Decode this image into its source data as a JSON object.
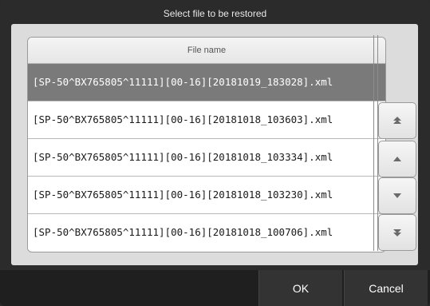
{
  "dialog": {
    "title": "Select file to be restored",
    "column_header": "File name",
    "selected_index": 0,
    "rows": [
      "[SP-50^BX765805^11111][00-16][20181019_183028].xml",
      "[SP-50^BX765805^11111][00-16][20181018_103603].xml",
      "[SP-50^BX765805^11111][00-16][20181018_103334].xml",
      "[SP-50^BX765805^11111][00-16][20181018_103230].xml",
      "[SP-50^BX765805^11111][00-16][20181018_100706].xml"
    ],
    "scroll_icons": [
      "scroll-top-icon",
      "scroll-up-icon",
      "scroll-down-icon",
      "scroll-bottom-icon"
    ]
  },
  "footer": {
    "ok_label": "OK",
    "cancel_label": "Cancel"
  },
  "colors": {
    "selected_row": "#7a7a7a",
    "panel": "#dcdcdc",
    "frame": "#2b2b2b"
  }
}
